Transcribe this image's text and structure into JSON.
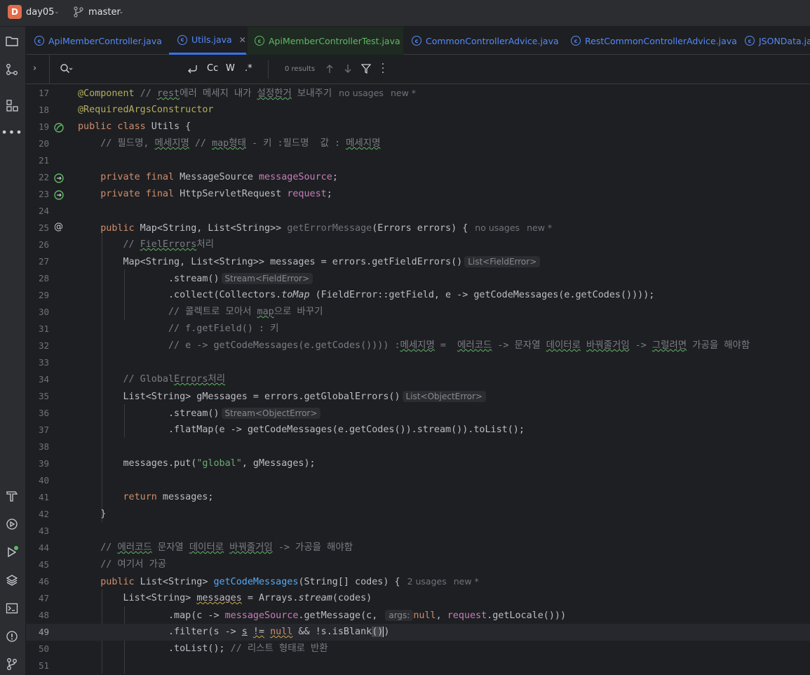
{
  "titlebar": {
    "project_badge": "D",
    "project_name": "day05",
    "branch": "master"
  },
  "tabs": [
    {
      "label": "ApiMemberController.java",
      "icon": "class-icon"
    },
    {
      "label": "Utils.java",
      "icon": "class-icon",
      "active": true
    },
    {
      "label": "ApiMemberControllerTest.java",
      "icon": "test-class-icon"
    },
    {
      "label": "CommonControllerAdvice.java",
      "icon": "class-icon"
    },
    {
      "label": "RestCommonControllerAdvice.java",
      "icon": "class-icon"
    },
    {
      "label": "JSONData.java",
      "icon": "class-icon"
    }
  ],
  "findbar": {
    "match_case": "Cc",
    "words": "W",
    "regex": ".*",
    "results": "0 results"
  },
  "editor": {
    "line_numbers": [
      "17",
      "18",
      "19",
      "20",
      "21",
      "22",
      "23",
      "24",
      "25",
      "26",
      "27",
      "28",
      "29",
      "30",
      "31",
      "32",
      "33",
      "34",
      "35",
      "36",
      "37",
      "38",
      "39",
      "40",
      "41",
      "42",
      "43",
      "44",
      "45",
      "46",
      "47",
      "48",
      "49",
      "50",
      "51"
    ],
    "current_line": "49",
    "hints": {
      "no_usages": "no usages",
      "new": "new *",
      "two_usages": "2 usages",
      "list_field_error": "List<FieldError>",
      "stream_field_error": "Stream<FieldError>",
      "list_object_error": "List<ObjectError>",
      "stream_object_error": "Stream<ObjectError>",
      "args": "args:"
    }
  }
}
